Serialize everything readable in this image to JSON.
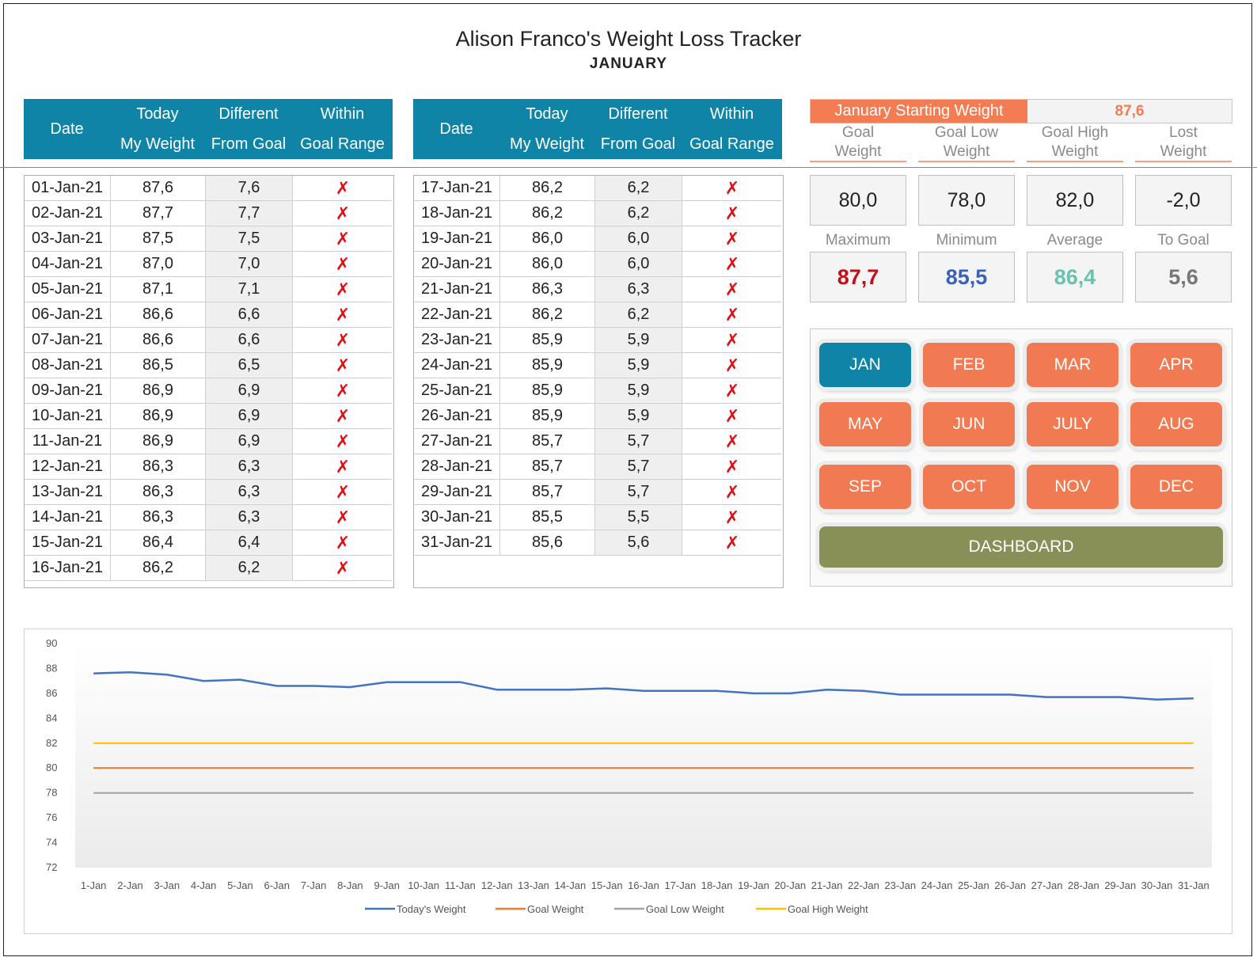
{
  "title": "Alison Franco's Weight Loss Tracker",
  "subtitle": "JANUARY",
  "table_headers": {
    "date": "Date",
    "weight_1": "Today",
    "weight_2": "My Weight",
    "diff_1": "Different",
    "diff_2": "From Goal",
    "within_1": "Within",
    "within_2": "Goal Range"
  },
  "rows_left": [
    {
      "date": "01-Jan-21",
      "weight": "87,6",
      "diff": "7,6",
      "within": "✗"
    },
    {
      "date": "02-Jan-21",
      "weight": "87,7",
      "diff": "7,7",
      "within": "✗"
    },
    {
      "date": "03-Jan-21",
      "weight": "87,5",
      "diff": "7,5",
      "within": "✗"
    },
    {
      "date": "04-Jan-21",
      "weight": "87,0",
      "diff": "7,0",
      "within": "✗"
    },
    {
      "date": "05-Jan-21",
      "weight": "87,1",
      "diff": "7,1",
      "within": "✗"
    },
    {
      "date": "06-Jan-21",
      "weight": "86,6",
      "diff": "6,6",
      "within": "✗"
    },
    {
      "date": "07-Jan-21",
      "weight": "86,6",
      "diff": "6,6",
      "within": "✗"
    },
    {
      "date": "08-Jan-21",
      "weight": "86,5",
      "diff": "6,5",
      "within": "✗"
    },
    {
      "date": "09-Jan-21",
      "weight": "86,9",
      "diff": "6,9",
      "within": "✗"
    },
    {
      "date": "10-Jan-21",
      "weight": "86,9",
      "diff": "6,9",
      "within": "✗"
    },
    {
      "date": "11-Jan-21",
      "weight": "86,9",
      "diff": "6,9",
      "within": "✗"
    },
    {
      "date": "12-Jan-21",
      "weight": "86,3",
      "diff": "6,3",
      "within": "✗"
    },
    {
      "date": "13-Jan-21",
      "weight": "86,3",
      "diff": "6,3",
      "within": "✗"
    },
    {
      "date": "14-Jan-21",
      "weight": "86,3",
      "diff": "6,3",
      "within": "✗"
    },
    {
      "date": "15-Jan-21",
      "weight": "86,4",
      "diff": "6,4",
      "within": "✗"
    },
    {
      "date": "16-Jan-21",
      "weight": "86,2",
      "diff": "6,2",
      "within": "✗"
    }
  ],
  "rows_right": [
    {
      "date": "17-Jan-21",
      "weight": "86,2",
      "diff": "6,2",
      "within": "✗"
    },
    {
      "date": "18-Jan-21",
      "weight": "86,2",
      "diff": "6,2",
      "within": "✗"
    },
    {
      "date": "19-Jan-21",
      "weight": "86,0",
      "diff": "6,0",
      "within": "✗"
    },
    {
      "date": "20-Jan-21",
      "weight": "86,0",
      "diff": "6,0",
      "within": "✗"
    },
    {
      "date": "21-Jan-21",
      "weight": "86,3",
      "diff": "6,3",
      "within": "✗"
    },
    {
      "date": "22-Jan-21",
      "weight": "86,2",
      "diff": "6,2",
      "within": "✗"
    },
    {
      "date": "23-Jan-21",
      "weight": "85,9",
      "diff": "5,9",
      "within": "✗"
    },
    {
      "date": "24-Jan-21",
      "weight": "85,9",
      "diff": "5,9",
      "within": "✗"
    },
    {
      "date": "25-Jan-21",
      "weight": "85,9",
      "diff": "5,9",
      "within": "✗"
    },
    {
      "date": "26-Jan-21",
      "weight": "85,9",
      "diff": "5,9",
      "within": "✗"
    },
    {
      "date": "27-Jan-21",
      "weight": "85,7",
      "diff": "5,7",
      "within": "✗"
    },
    {
      "date": "28-Jan-21",
      "weight": "85,7",
      "diff": "5,7",
      "within": "✗"
    },
    {
      "date": "29-Jan-21",
      "weight": "85,7",
      "diff": "5,7",
      "within": "✗"
    },
    {
      "date": "30-Jan-21",
      "weight": "85,5",
      "diff": "5,5",
      "within": "✗"
    },
    {
      "date": "31-Jan-21",
      "weight": "85,6",
      "diff": "5,6",
      "within": "✗"
    }
  ],
  "summary": {
    "starting_label": "January Starting Weight",
    "starting_value": "87,6",
    "labels_top": [
      {
        "l1": "Goal",
        "l2": "Weight"
      },
      {
        "l1": "Goal Low",
        "l2": "Weight"
      },
      {
        "l1": "Goal High",
        "l2": "Weight"
      },
      {
        "l1": "Lost",
        "l2": "Weight"
      }
    ],
    "values_top": [
      "80,0",
      "78,0",
      "82,0",
      "-2,0"
    ],
    "labels_bottom": [
      "Maximum",
      "Minimum",
      "Average",
      "To Goal"
    ],
    "values_bottom": [
      "87,7",
      "85,5",
      "86,4",
      "5,6"
    ],
    "colors_bottom": [
      "#c0101a",
      "#3a62b8",
      "#6cc0b0",
      "#777777"
    ]
  },
  "months": [
    "JAN",
    "FEB",
    "MAR",
    "APR",
    "MAY",
    "JUN",
    "JULY",
    "AUG",
    "SEP",
    "OCT",
    "NOV",
    "DEC"
  ],
  "active_month": "JAN",
  "dashboard_label": "DASHBOARD",
  "chart_data": {
    "type": "line",
    "categories": [
      "1-Jan",
      "2-Jan",
      "3-Jan",
      "4-Jan",
      "5-Jan",
      "6-Jan",
      "7-Jan",
      "8-Jan",
      "9-Jan",
      "10-Jan",
      "11-Jan",
      "12-Jan",
      "13-Jan",
      "14-Jan",
      "15-Jan",
      "16-Jan",
      "17-Jan",
      "18-Jan",
      "19-Jan",
      "20-Jan",
      "21-Jan",
      "22-Jan",
      "23-Jan",
      "24-Jan",
      "25-Jan",
      "26-Jan",
      "27-Jan",
      "28-Jan",
      "29-Jan",
      "30-Jan",
      "31-Jan"
    ],
    "series": [
      {
        "name": "Today's Weight",
        "color": "#4472c4",
        "values": [
          87.6,
          87.7,
          87.5,
          87.0,
          87.1,
          86.6,
          86.6,
          86.5,
          86.9,
          86.9,
          86.9,
          86.3,
          86.3,
          86.3,
          86.4,
          86.2,
          86.2,
          86.2,
          86.0,
          86.0,
          86.3,
          86.2,
          85.9,
          85.9,
          85.9,
          85.9,
          85.7,
          85.7,
          85.7,
          85.5,
          85.6
        ]
      },
      {
        "name": "Goal Weight",
        "color": "#ed7d31",
        "values": [
          80,
          80,
          80,
          80,
          80,
          80,
          80,
          80,
          80,
          80,
          80,
          80,
          80,
          80,
          80,
          80,
          80,
          80,
          80,
          80,
          80,
          80,
          80,
          80,
          80,
          80,
          80,
          80,
          80,
          80,
          80
        ]
      },
      {
        "name": "Goal Low Weight",
        "color": "#a5a5a5",
        "values": [
          78,
          78,
          78,
          78,
          78,
          78,
          78,
          78,
          78,
          78,
          78,
          78,
          78,
          78,
          78,
          78,
          78,
          78,
          78,
          78,
          78,
          78,
          78,
          78,
          78,
          78,
          78,
          78,
          78,
          78,
          78
        ]
      },
      {
        "name": "Goal High Weight",
        "color": "#ffc000",
        "values": [
          82,
          82,
          82,
          82,
          82,
          82,
          82,
          82,
          82,
          82,
          82,
          82,
          82,
          82,
          82,
          82,
          82,
          82,
          82,
          82,
          82,
          82,
          82,
          82,
          82,
          82,
          82,
          82,
          82,
          82,
          82
        ]
      }
    ],
    "ylim": [
      72,
      90
    ],
    "yticks": [
      "90",
      "88",
      "86",
      "84",
      "82",
      "80",
      "78",
      "76",
      "74",
      "72"
    ],
    "legend": "bottom",
    "grid": false
  }
}
